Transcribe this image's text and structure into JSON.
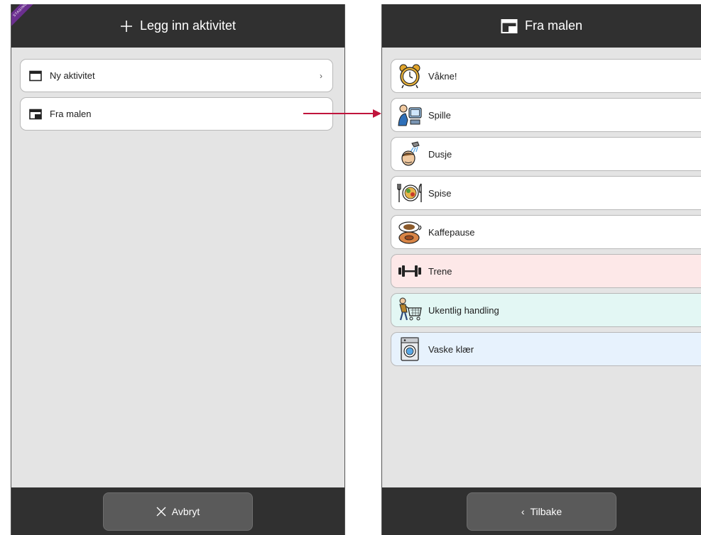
{
  "left_screen": {
    "ribbon": "STAGING",
    "title": "Legg inn aktivitet",
    "items": [
      {
        "label": "Ny aktivitet",
        "icon": "calendar-icon",
        "chevron": "›"
      },
      {
        "label": "Fra malen",
        "icon": "template-icon"
      }
    ],
    "cancel_label": "Avbryt"
  },
  "right_screen": {
    "title": "Fra malen",
    "templates": [
      {
        "label": "Våkne!",
        "icon": "alarm-clock-icon",
        "background": "#ffffff"
      },
      {
        "label": "Spille",
        "icon": "computer-game-icon",
        "background": "#ffffff"
      },
      {
        "label": "Dusje",
        "icon": "shower-icon",
        "background": "#ffffff"
      },
      {
        "label": "Spise",
        "icon": "meal-plate-icon",
        "background": "#ffffff"
      },
      {
        "label": "Kaffepause",
        "icon": "coffee-cup-icon",
        "background": "#ffffff"
      },
      {
        "label": "Trene",
        "icon": "dumbbell-icon",
        "background": "#fde8e8"
      },
      {
        "label": "Ukentlig handling",
        "icon": "shopping-cart-icon",
        "background": "#e3f7f4"
      },
      {
        "label": "Vaske klær",
        "icon": "washing-machine-icon",
        "background": "#e7f2fd"
      }
    ],
    "back_label": "Tilbake"
  },
  "colors": {
    "topbar": "#303030",
    "screen_background": "#e4e4e4",
    "arrow": "#c0143c",
    "ribbon": "#6b2f8f"
  }
}
